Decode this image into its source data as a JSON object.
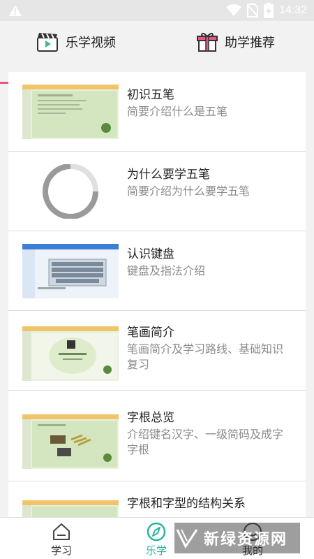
{
  "status_bar": {
    "time": "14:32",
    "icons": [
      "warning-icon",
      "wifi-icon",
      "no-sim-icon",
      "battery-charging-icon"
    ]
  },
  "tabs": [
    {
      "label": "乐学视频",
      "icon": "video-clapper-icon",
      "active": true
    },
    {
      "label": "助学推荐",
      "icon": "gift-icon",
      "active": false
    }
  ],
  "lessons": [
    {
      "title": "初识五笔",
      "description": "简要介绍什么是五笔",
      "thumb": "slide"
    },
    {
      "title": "为什么要学五笔",
      "description": "简要介绍为什么要学五笔",
      "thumb": "loading"
    },
    {
      "title": "认识键盘",
      "description": "键盘及指法介绍",
      "thumb": "keyboard"
    },
    {
      "title": "笔画简介",
      "description": "笔画简介及学习路线、基础知识复习",
      "thumb": "slide-title"
    },
    {
      "title": "字根总览",
      "description": "介绍键名汉字、一级简码及成字字根",
      "thumb": "slide-images"
    },
    {
      "title": "字根和字型的结构关系",
      "description": "",
      "thumb": "slide"
    }
  ],
  "bottom_nav": [
    {
      "label": "学习",
      "icon": "home-icon",
      "active": false
    },
    {
      "label": "乐学",
      "icon": "compass-icon",
      "active": true
    },
    {
      "label": "我的",
      "icon": "user-icon",
      "active": false
    }
  ],
  "watermark": {
    "text": "新绿资源网"
  },
  "colors": {
    "accent_pink": "#e8588a",
    "active_teal": "#2bb5a0",
    "status_bar_bg": "#e6e6e6"
  }
}
